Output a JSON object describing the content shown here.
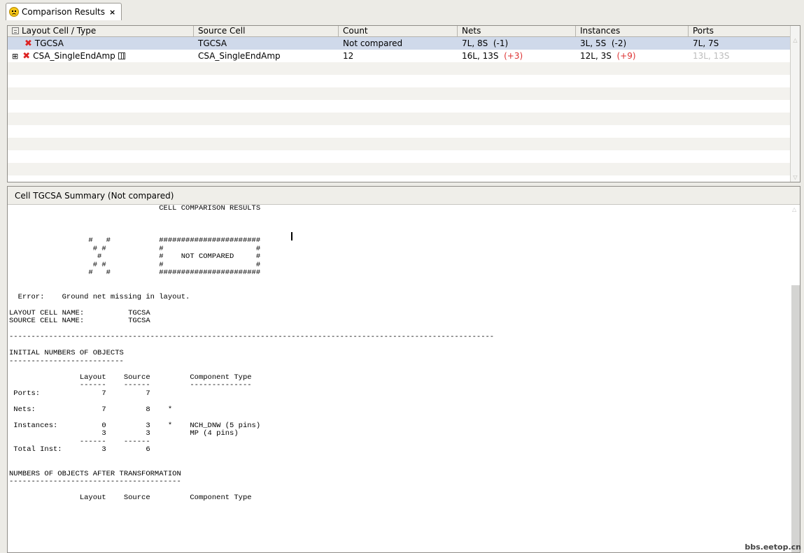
{
  "tab": {
    "title": "Comparison Results",
    "close": "×"
  },
  "columns": [
    "Layout Cell / Type",
    "Source Cell",
    "Count",
    "Nets",
    "Instances",
    "Ports"
  ],
  "rows": [
    {
      "layout": "TGCSA",
      "source": "TGCSA",
      "count": "Not compared",
      "nets": "7L, 8S",
      "nets_delta": "(-1)",
      "inst": "3L, 5S",
      "inst_delta": "(-2)",
      "ports": "7L, 7S"
    },
    {
      "expander": "⊞",
      "layout": "CSA_SingleEndAmp",
      "source": "CSA_SingleEndAmp",
      "count": "12",
      "nets": "16L, 13S",
      "nets_delta": "(+3)",
      "inst": "12L, 3S",
      "inst_delta": "(+9)",
      "ports": "13L, 13S"
    }
  ],
  "summary": {
    "title": "Cell TGCSA Summary (Not compared)",
    "report": "                                  CELL COMPARISON RESULTS\n\n\n\n                  #   #           #######################\n                   # #            #                     #\n                    #             #    NOT COMPARED     #\n                   # #            #                     #\n                  #   #           #######################\n\n\n  Error:    Ground net missing in layout.\n\nLAYOUT CELL NAME:          TGCSA\nSOURCE CELL NAME:          TGCSA\n\n--------------------------------------------------------------------------------------------------------------\n\nINITIAL NUMBERS OF OBJECTS\n--------------------------\n\n                Layout    Source         Component Type\n                ------    ------         --------------\n Ports:              7         7\n\n Nets:               7         8    *\n\n Instances:          0         3    *    NCH_DNW (5 pins)\n                     3         3         MP (4 pins)\n                ------    ------\n Total Inst:         3         6\n\n\nNUMBERS OF OBJECTS AFTER TRANSFORMATION\n---------------------------------------\n\n                Layout    Source         Component Type"
  },
  "watermark": "bbs.eetop.cn"
}
